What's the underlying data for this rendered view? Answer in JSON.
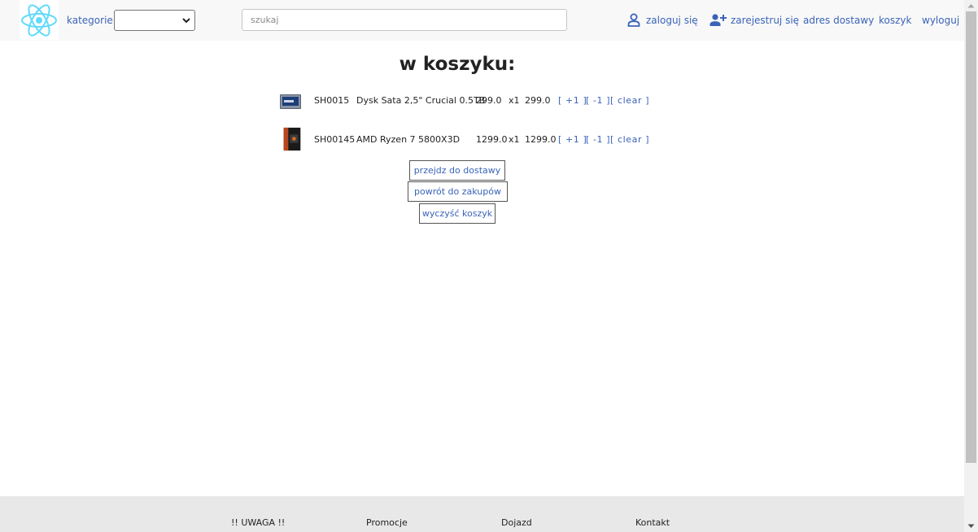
{
  "header": {
    "logo_icon": "react-atom-icon",
    "categories_label": "kategorie",
    "categories_selected": "",
    "search_placeholder": "szukaj",
    "login_label": "zaloguj się",
    "register_label": "zarejestruj się",
    "delivery_address_label": "adres dostawy",
    "cart_label": "koszyk",
    "logout_label": "wyloguj"
  },
  "cart": {
    "title": "w koszyku:",
    "items": [
      {
        "code": "SH0015",
        "name": "Dysk Sata 2,5\" Crucial 0.5TB",
        "price": "299.0",
        "qty": "x1",
        "total": "299.0",
        "inc": "[ +1 ]",
        "dec": "[ -1 ]",
        "clear": "[ clear ]",
        "thumb_icon": "ssd-drive-icon"
      },
      {
        "code": "SH00145",
        "name": "AMD Ryzen 7 5800X3D",
        "price": "1299.0",
        "qty": "x1",
        "total": "1299.0",
        "inc": "[ +1 ]",
        "dec": "[ -1 ]",
        "clear": "[ clear ]",
        "thumb_icon": "cpu-box-icon"
      }
    ],
    "checkout_label": "przejdz do dostawy",
    "back_label": "powrót do zakupów",
    "clear_all_label": "wyczyść koszyk"
  },
  "footer": {
    "links": [
      "!! UWAGA !!",
      "Promocje",
      "Dojazd",
      "Kontakt"
    ]
  },
  "colors": {
    "link": "#3a63b8",
    "react_logo": "#61dafb",
    "header_bg": "#f8f8f8",
    "footer_bg": "#e8e8e8"
  }
}
